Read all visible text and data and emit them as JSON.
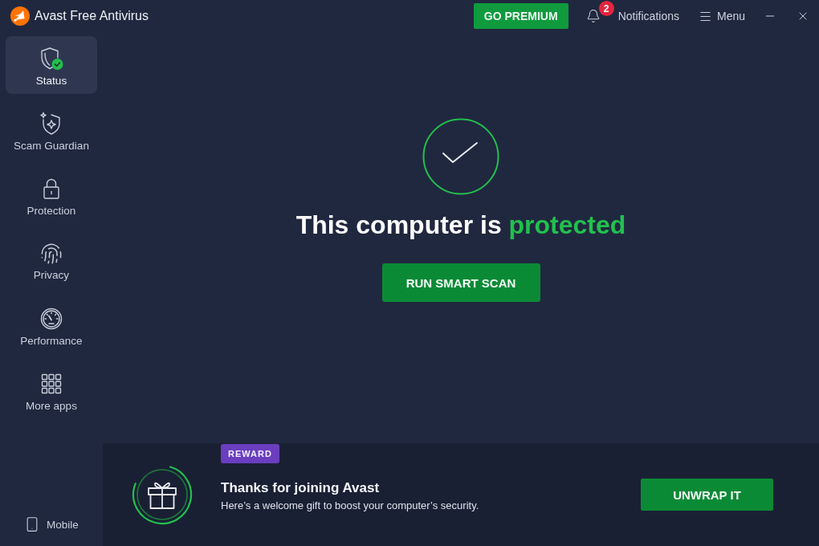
{
  "title_bar": {
    "app_name": "Avast Free Antivirus",
    "premium_button": "GO PREMIUM",
    "notifications": {
      "label": "Notifications",
      "count": "2"
    },
    "menu": "Menu"
  },
  "sidebar": {
    "items": [
      {
        "kind": "status",
        "label": "Status",
        "selected": true
      },
      {
        "kind": "scam",
        "label": "Scam Guardian",
        "selected": false
      },
      {
        "kind": "protection",
        "label": "Protection",
        "selected": false
      },
      {
        "kind": "privacy",
        "label": "Privacy",
        "selected": false
      },
      {
        "kind": "performance",
        "label": "Performance",
        "selected": false
      },
      {
        "kind": "apps",
        "label": "More apps",
        "selected": false
      }
    ],
    "footer": {
      "label": "Mobile"
    }
  },
  "status": {
    "protected": true,
    "headline": "This computer is",
    "headline_state": "protected",
    "scan_button": "RUN SMART SCAN"
  },
  "reward_banner": {
    "badge": "REWARD",
    "title": "Thanks for joining Avast",
    "subtitle": "Here’s a welcome gift to boost your computer’s security.",
    "button": "UNWRAP IT"
  }
}
